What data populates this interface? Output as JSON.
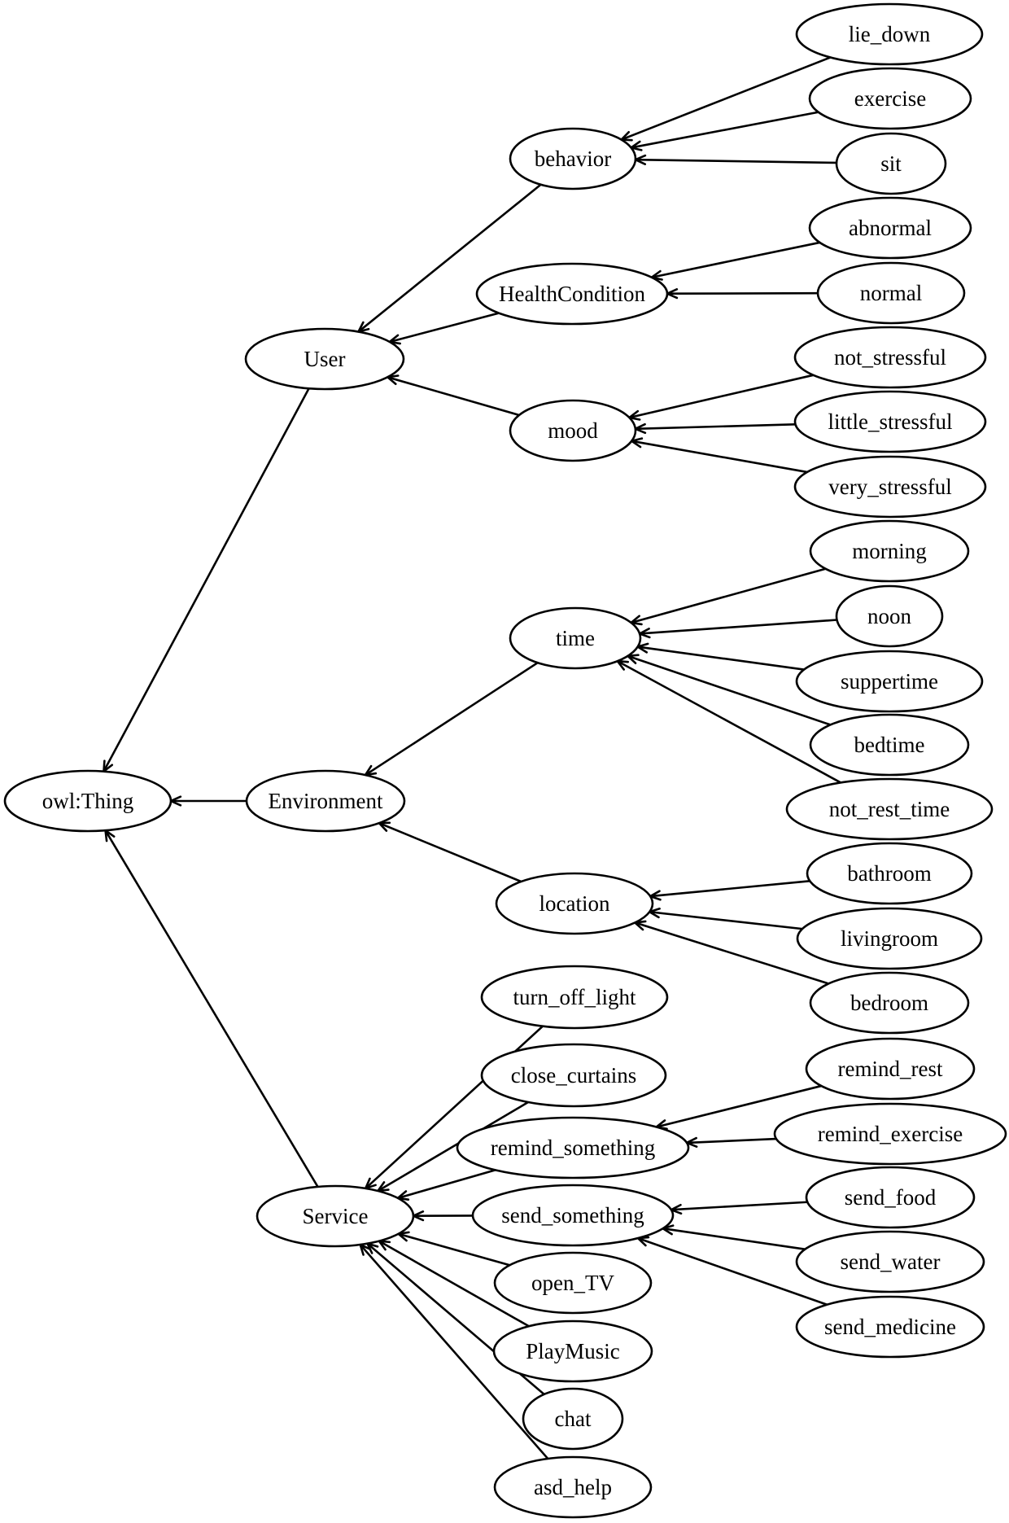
{
  "diagram": {
    "title": "",
    "root": "owl:Thing",
    "nodes": [
      {
        "id": "owl_thing",
        "label": "owl:Thing"
      },
      {
        "id": "user",
        "label": "User"
      },
      {
        "id": "environment",
        "label": "Environment"
      },
      {
        "id": "service",
        "label": "Service"
      },
      {
        "id": "behavior",
        "label": "behavior"
      },
      {
        "id": "healthcondition",
        "label": "HealthCondition"
      },
      {
        "id": "mood",
        "label": "mood"
      },
      {
        "id": "time",
        "label": "time"
      },
      {
        "id": "location",
        "label": "location"
      },
      {
        "id": "turn_off_light",
        "label": "turn_off_light"
      },
      {
        "id": "close_curtains",
        "label": "close_curtains"
      },
      {
        "id": "remind_something",
        "label": "remind_something"
      },
      {
        "id": "send_something",
        "label": "send_something"
      },
      {
        "id": "open_tv",
        "label": "open_TV"
      },
      {
        "id": "playmusic",
        "label": "PlayMusic"
      },
      {
        "id": "chat",
        "label": "chat"
      },
      {
        "id": "asd_help",
        "label": "asd_help"
      },
      {
        "id": "lie_down",
        "label": "lie_down"
      },
      {
        "id": "exercise",
        "label": "exercise"
      },
      {
        "id": "sit",
        "label": "sit"
      },
      {
        "id": "abnormal",
        "label": "abnormal"
      },
      {
        "id": "normal",
        "label": "normal"
      },
      {
        "id": "not_stressful",
        "label": "not_stressful"
      },
      {
        "id": "little_stressful",
        "label": "little_stressful"
      },
      {
        "id": "very_stressful",
        "label": "very_stressful"
      },
      {
        "id": "morning",
        "label": "morning"
      },
      {
        "id": "noon",
        "label": "noon"
      },
      {
        "id": "suppertime",
        "label": "suppertime"
      },
      {
        "id": "bedtime",
        "label": "bedtime"
      },
      {
        "id": "not_rest_time",
        "label": "not_rest_time"
      },
      {
        "id": "bathroom",
        "label": "bathroom"
      },
      {
        "id": "livingroom",
        "label": "livingroom"
      },
      {
        "id": "bedroom",
        "label": "bedroom"
      },
      {
        "id": "remind_rest",
        "label": "remind_rest"
      },
      {
        "id": "remind_exercise",
        "label": "remind_exercise"
      },
      {
        "id": "send_food",
        "label": "send_food"
      },
      {
        "id": "send_water",
        "label": "send_water"
      },
      {
        "id": "send_medicine",
        "label": "send_medicine"
      }
    ],
    "edges": [
      {
        "from": "user",
        "to": "owl_thing"
      },
      {
        "from": "environment",
        "to": "owl_thing"
      },
      {
        "from": "service",
        "to": "owl_thing"
      },
      {
        "from": "behavior",
        "to": "user"
      },
      {
        "from": "healthcondition",
        "to": "user"
      },
      {
        "from": "mood",
        "to": "user"
      },
      {
        "from": "time",
        "to": "environment"
      },
      {
        "from": "location",
        "to": "environment"
      },
      {
        "from": "turn_off_light",
        "to": "service"
      },
      {
        "from": "close_curtains",
        "to": "service"
      },
      {
        "from": "remind_something",
        "to": "service"
      },
      {
        "from": "send_something",
        "to": "service"
      },
      {
        "from": "open_tv",
        "to": "service"
      },
      {
        "from": "playmusic",
        "to": "service"
      },
      {
        "from": "chat",
        "to": "service"
      },
      {
        "from": "asd_help",
        "to": "service"
      },
      {
        "from": "lie_down",
        "to": "behavior"
      },
      {
        "from": "exercise",
        "to": "behavior"
      },
      {
        "from": "sit",
        "to": "behavior"
      },
      {
        "from": "abnormal",
        "to": "healthcondition"
      },
      {
        "from": "normal",
        "to": "healthcondition"
      },
      {
        "from": "not_stressful",
        "to": "mood"
      },
      {
        "from": "little_stressful",
        "to": "mood"
      },
      {
        "from": "very_stressful",
        "to": "mood"
      },
      {
        "from": "morning",
        "to": "time"
      },
      {
        "from": "noon",
        "to": "time"
      },
      {
        "from": "suppertime",
        "to": "time"
      },
      {
        "from": "bedtime",
        "to": "time"
      },
      {
        "from": "not_rest_time",
        "to": "time"
      },
      {
        "from": "bathroom",
        "to": "location"
      },
      {
        "from": "livingroom",
        "to": "location"
      },
      {
        "from": "bedroom",
        "to": "location"
      },
      {
        "from": "remind_rest",
        "to": "remind_something"
      },
      {
        "from": "remind_exercise",
        "to": "remind_something"
      },
      {
        "from": "send_food",
        "to": "send_something"
      },
      {
        "from": "send_water",
        "to": "send_something"
      },
      {
        "from": "send_medicine",
        "to": "send_something"
      }
    ]
  }
}
